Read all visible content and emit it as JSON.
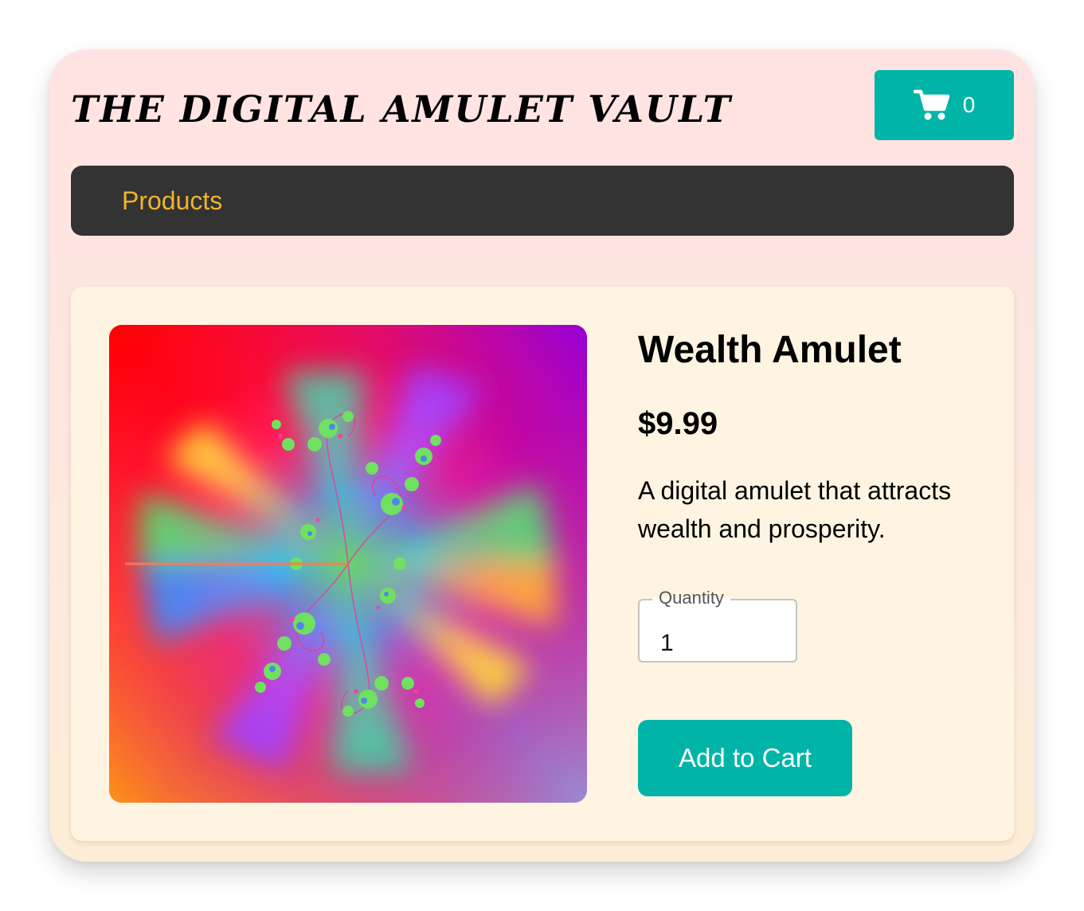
{
  "header": {
    "site_title": "THE DIGITAL AMULET VAULT",
    "cart": {
      "icon": "shopping-cart-icon",
      "count": "0"
    }
  },
  "nav": {
    "items": [
      {
        "label": "Products"
      }
    ]
  },
  "product": {
    "name": "Wealth Amulet",
    "price": "$9.99",
    "description": "A digital amulet that attracts wealth and prosperity.",
    "image_icon": "fractal-amulet-image",
    "quantity": {
      "label": "Quantity",
      "value": "1"
    },
    "add_to_cart_label": "Add to Cart"
  },
  "colors": {
    "accent": "#00b5a8",
    "nav_background": "#333333",
    "nav_link": "#f0b429",
    "card_background": "#fff4e2",
    "page_background_top": "#ffe3e3",
    "page_background_bottom": "#feedd6"
  }
}
